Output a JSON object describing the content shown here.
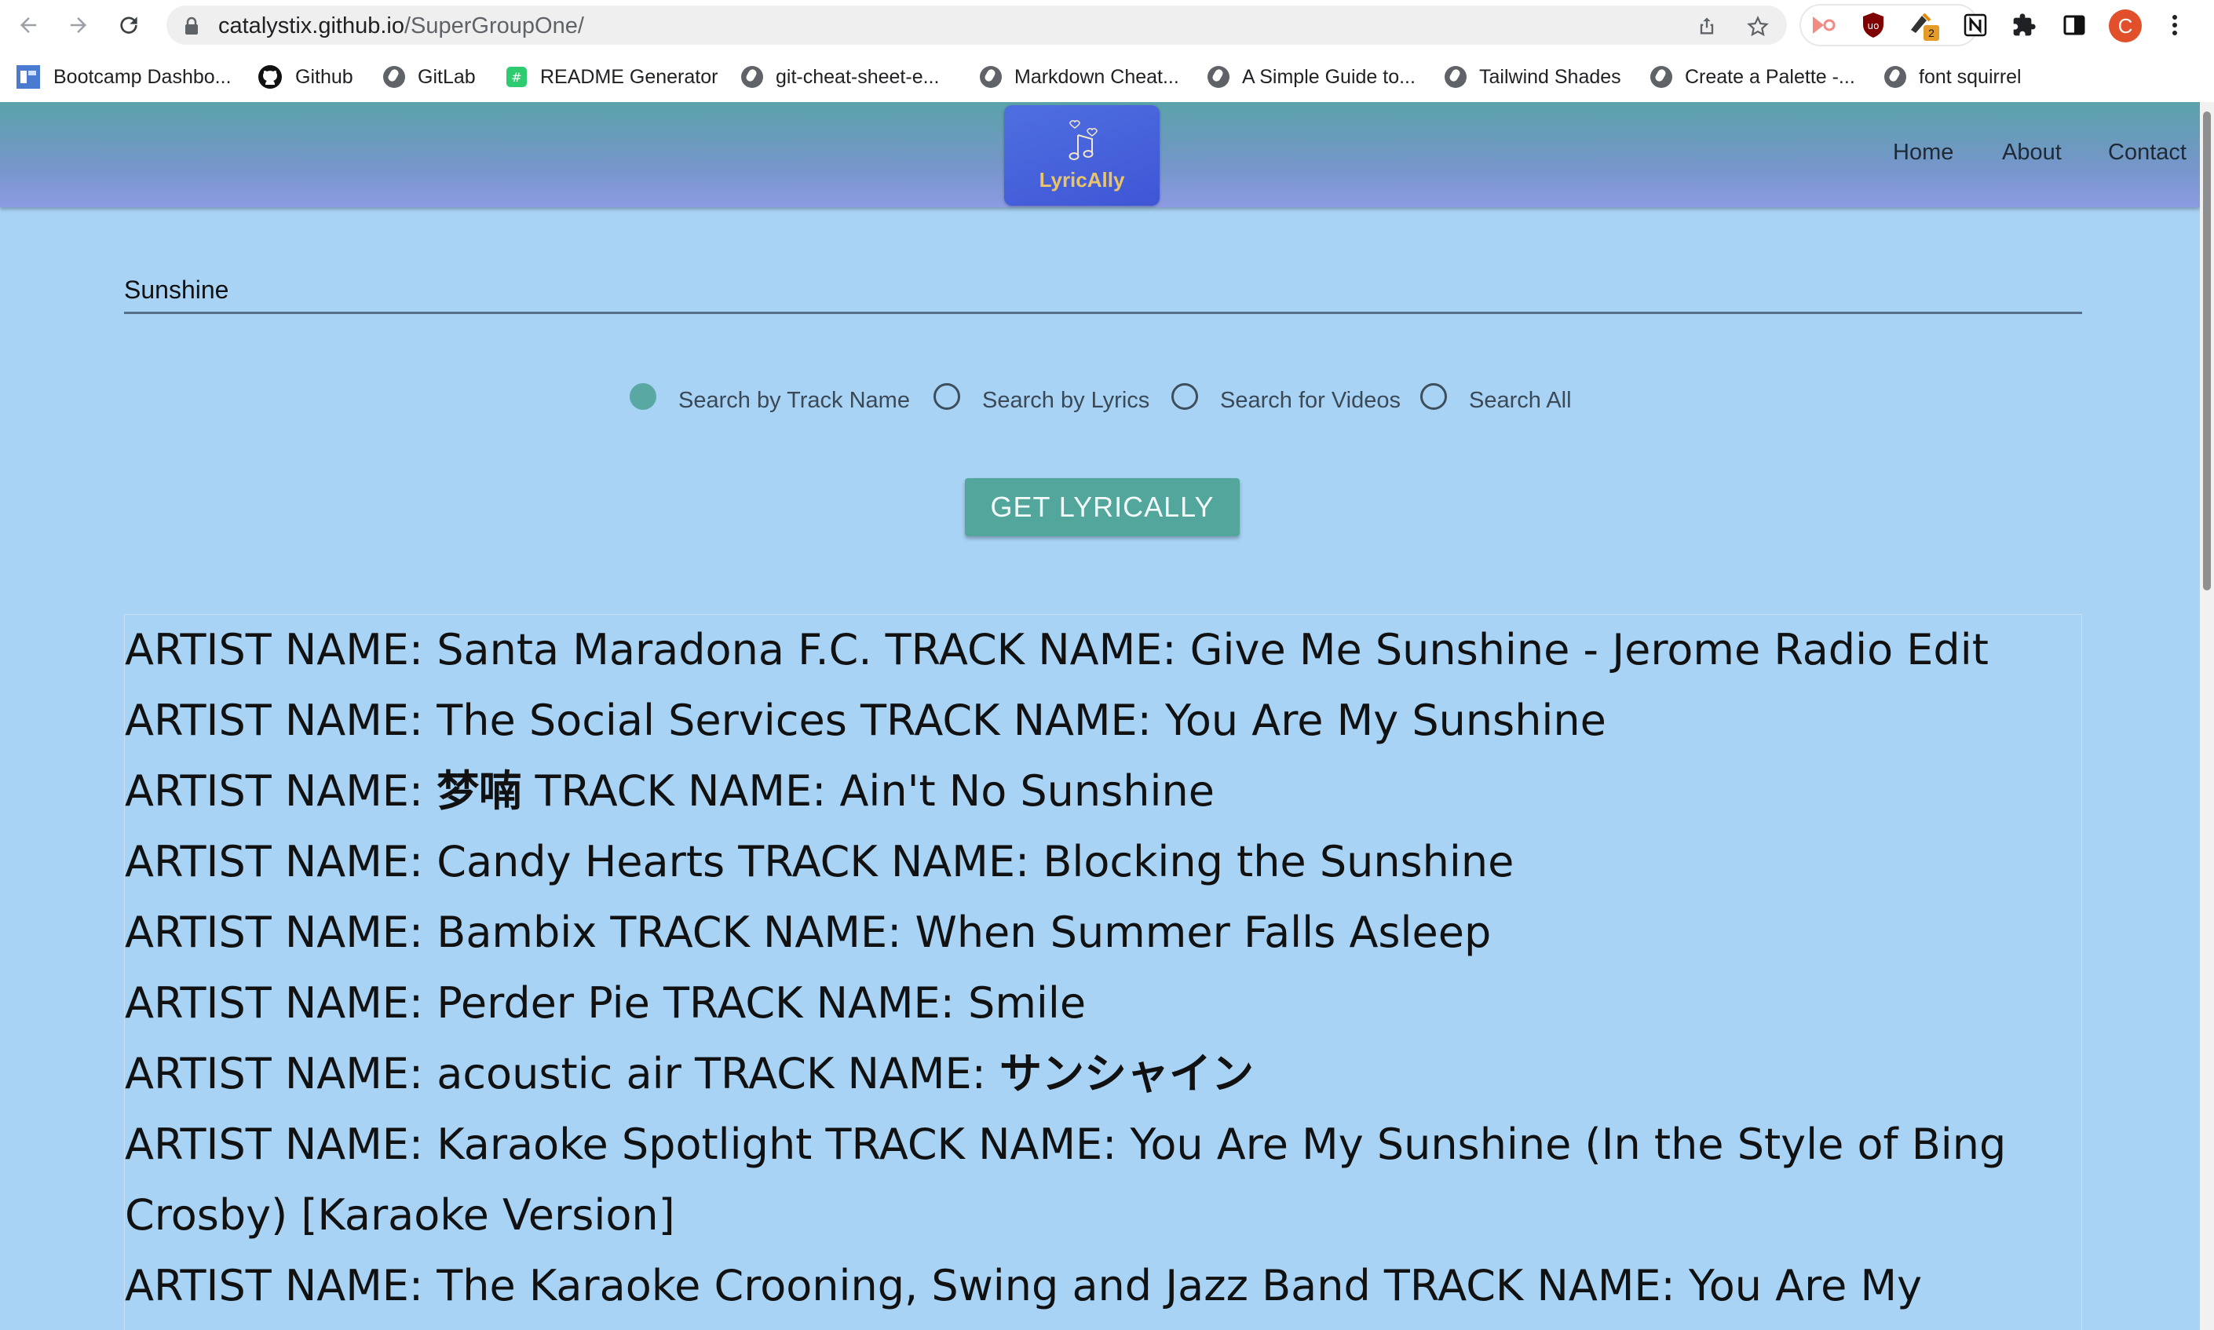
{
  "browser": {
    "url_host": "catalystix.github.io",
    "url_path": "/SuperGroupOne/",
    "profile_initial": "C",
    "extension_badge": "2",
    "bookmarks": [
      {
        "label": "Bootcamp Dashbo...",
        "icon": "bootcamp-icon"
      },
      {
        "label": "Github",
        "icon": "github-icon"
      },
      {
        "label": "GitLab",
        "icon": "globe-icon"
      },
      {
        "label": "README Generator",
        "icon": "readme-icon"
      },
      {
        "label": "git-cheat-sheet-e...",
        "icon": "globe-icon"
      },
      {
        "label": "Markdown Cheat...",
        "icon": "globe-icon"
      },
      {
        "label": "A Simple Guide to...",
        "icon": "globe-icon"
      },
      {
        "label": "Tailwind Shades",
        "icon": "globe-icon"
      },
      {
        "label": "Create a Palette -...",
        "icon": "globe-icon"
      },
      {
        "label": "font squirrel",
        "icon": "globe-icon"
      }
    ]
  },
  "header": {
    "logo_text": "LyricAlly",
    "nav": [
      "Home",
      "About",
      "Contact"
    ]
  },
  "search": {
    "value": "Sunshine",
    "options": [
      {
        "label": "Search by Track Name",
        "checked": true
      },
      {
        "label": "Search by Lyrics",
        "checked": false
      },
      {
        "label": "Search for Videos",
        "checked": false
      },
      {
        "label": "Search All",
        "checked": false
      }
    ],
    "button_label": "GET LYRICALLY"
  },
  "results": [
    {
      "artist": "Santa Maradona F.C.",
      "track": "Give Me Sunshine - Jerome Radio Edit"
    },
    {
      "artist": "The Social Services",
      "track": "You Are My Sunshine"
    },
    {
      "artist": "梦喃",
      "track": "Ain't No Sunshine"
    },
    {
      "artist": "Candy Hearts",
      "track": "Blocking the Sunshine"
    },
    {
      "artist": "Bambix",
      "track": "When Summer Falls Asleep"
    },
    {
      "artist": "Perder Pie",
      "track": "Smile"
    },
    {
      "artist": "acoustic air",
      "track": "サンシャイン"
    },
    {
      "artist": "Karaoke Spotlight",
      "track": "You Are My Sunshine (In the Style of Bing Crosby) [Karaoke Version]"
    },
    {
      "artist": "The Karaoke Crooning, Swing and Jazz Band",
      "track": "You Are My"
    }
  ],
  "labels": {
    "artist_prefix": "ARTIST NAME: ",
    "track_prefix": " TRACK NAME: "
  },
  "colors": {
    "page_bg": "#a8d3f5",
    "accent": "#52a69b",
    "logo_bg": "#3f56d6",
    "logo_text": "#e9c46a"
  }
}
